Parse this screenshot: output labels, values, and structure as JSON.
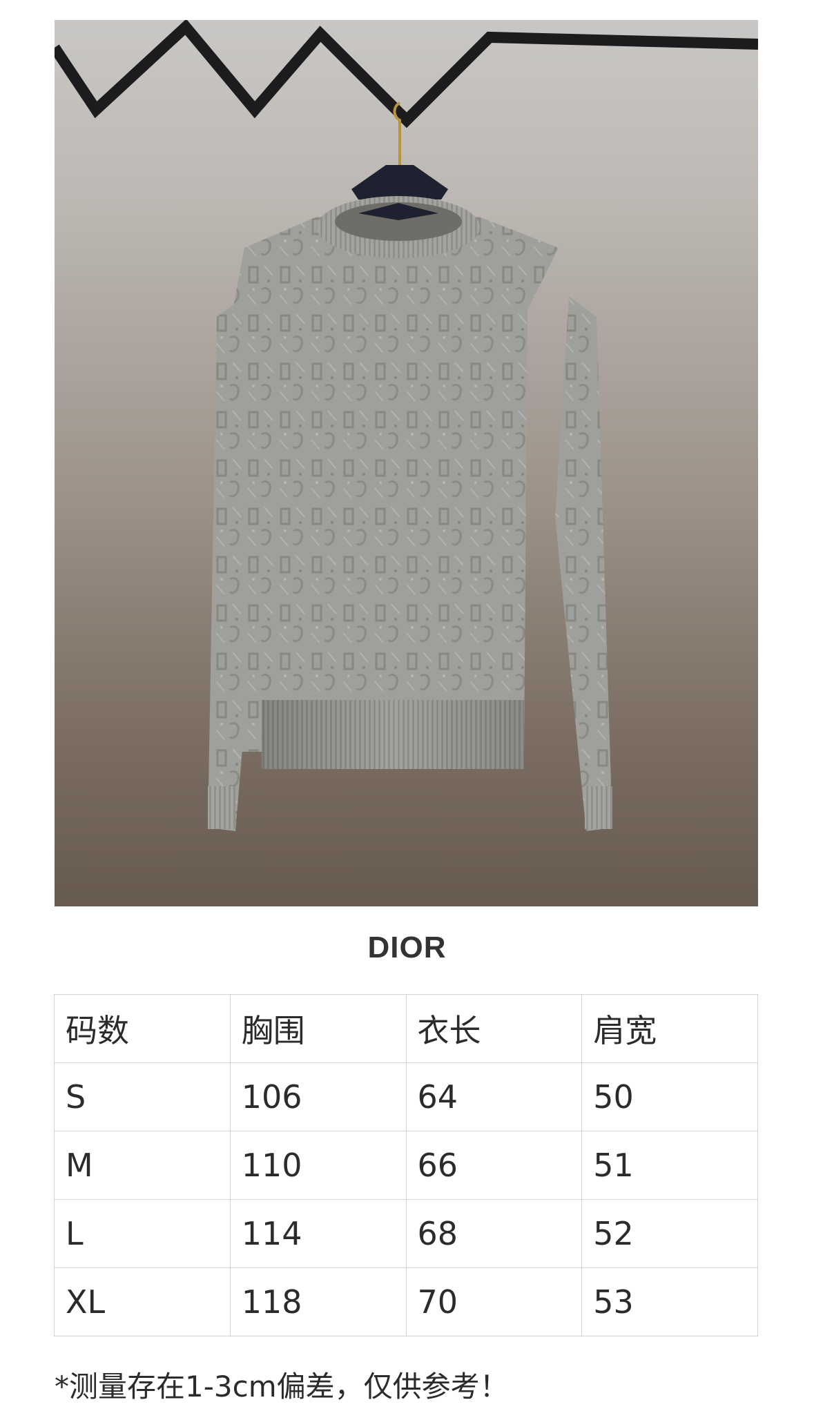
{
  "product": {
    "image_icon": "grey-knit-sweater-on-hanger",
    "background_colors": [
      "#c9c7c5",
      "#675a4f"
    ],
    "sweater_color": "#9d9e99"
  },
  "brand": "DIOR",
  "size_table": {
    "headers": [
      "码数",
      "胸围",
      "衣长",
      "肩宽"
    ],
    "rows": [
      [
        "S",
        "106",
        "64",
        "50"
      ],
      [
        "M",
        "110",
        "66",
        "51"
      ],
      [
        "L",
        "114",
        "68",
        "52"
      ],
      [
        "XL",
        "118",
        "70",
        "53"
      ]
    ]
  },
  "note": "*测量存在1-3cm偏差，仅供参考！"
}
